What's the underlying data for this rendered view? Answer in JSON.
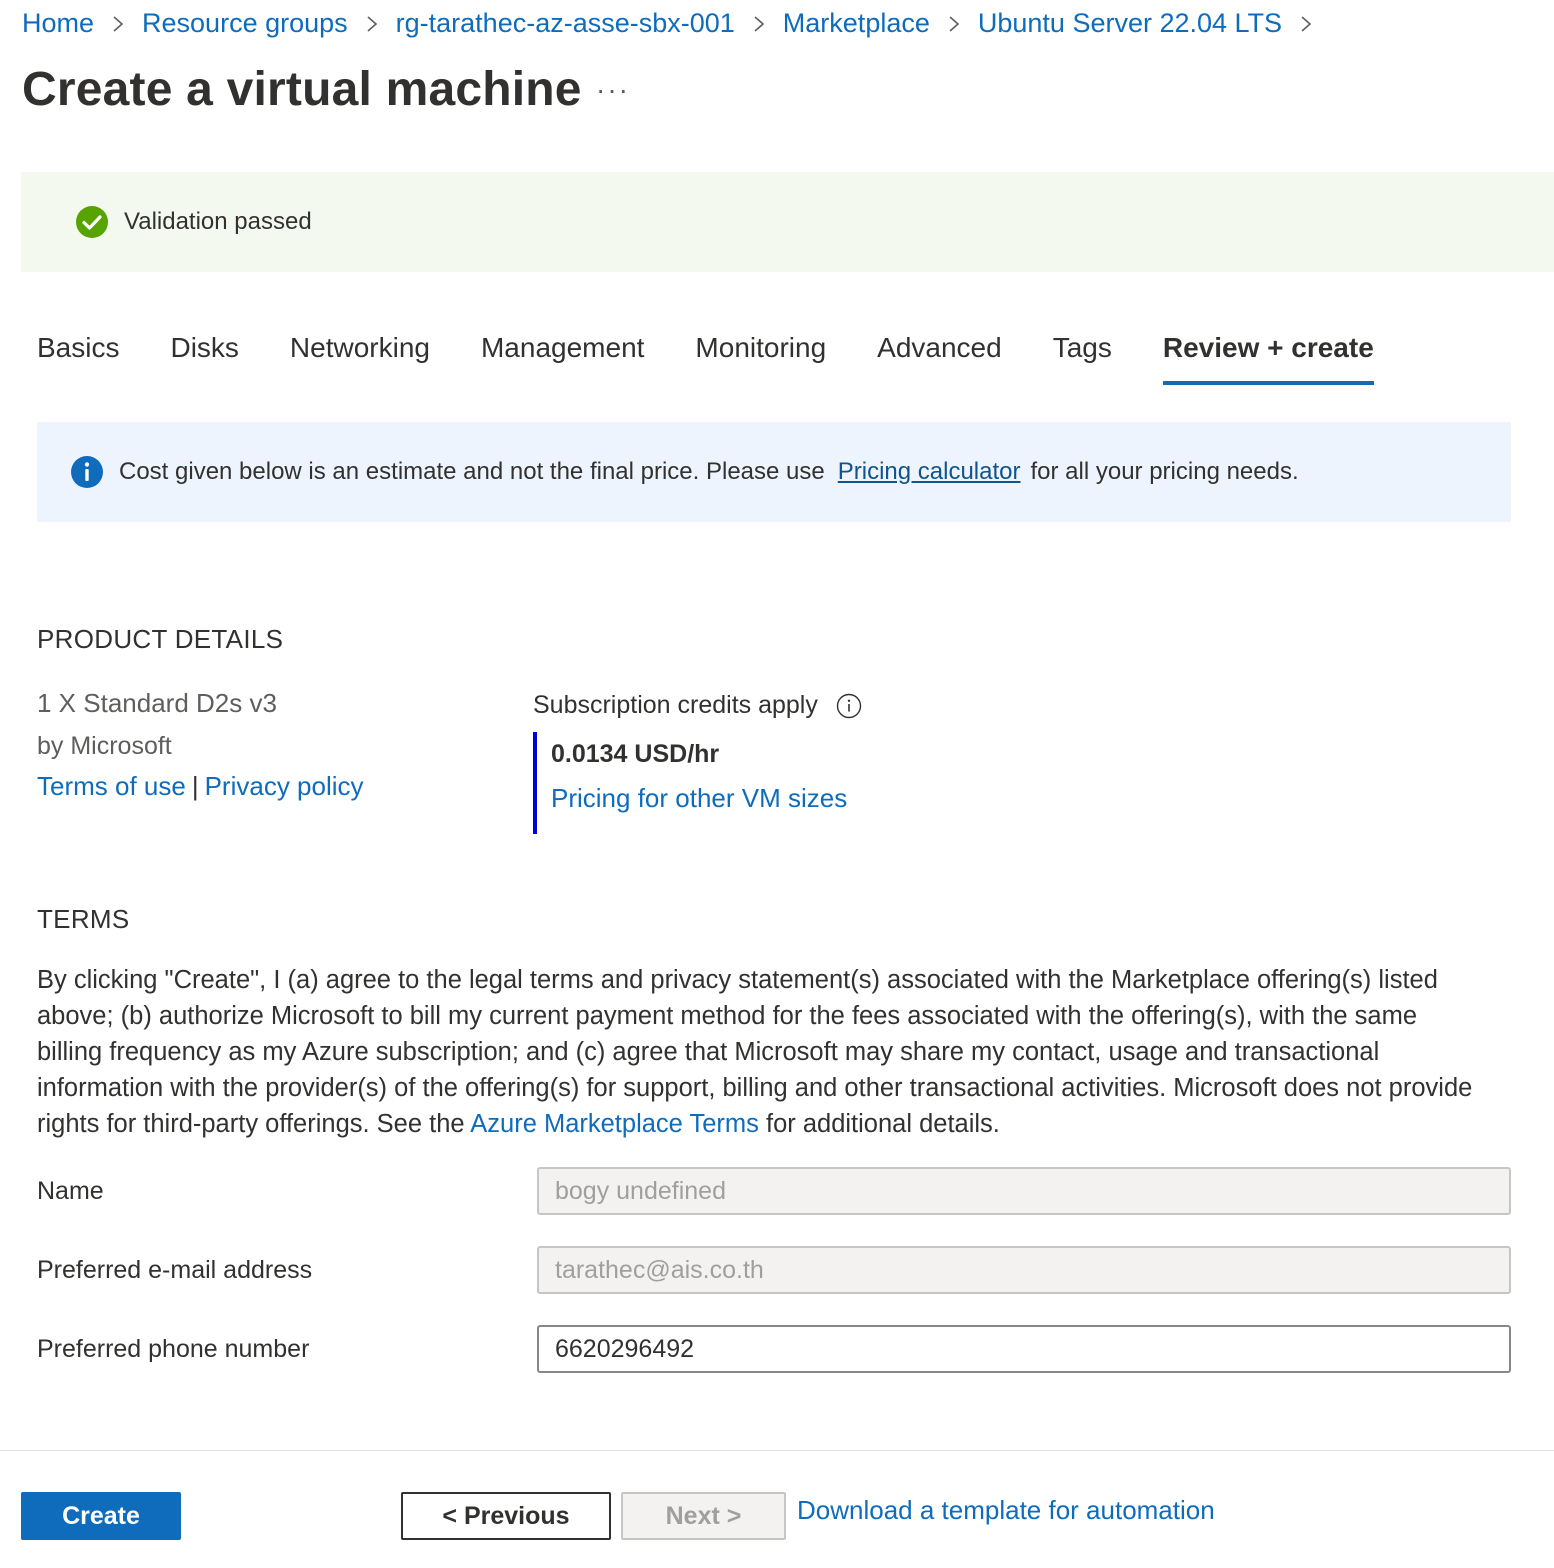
{
  "breadcrumb": {
    "items": [
      {
        "label": "Home"
      },
      {
        "label": "Resource groups"
      },
      {
        "label": "rg-tarathec-az-asse-sbx-001"
      },
      {
        "label": "Marketplace"
      },
      {
        "label": "Ubuntu Server 22.04 LTS"
      }
    ]
  },
  "header": {
    "title": "Create a virtual machine",
    "more_label": "···"
  },
  "validation": {
    "text": "Validation passed",
    "status_color": "#57a300"
  },
  "tabs": [
    {
      "label": "Basics",
      "active": false
    },
    {
      "label": "Disks",
      "active": false
    },
    {
      "label": "Networking",
      "active": false
    },
    {
      "label": "Management",
      "active": false
    },
    {
      "label": "Monitoring",
      "active": false
    },
    {
      "label": "Advanced",
      "active": false
    },
    {
      "label": "Tags",
      "active": false
    },
    {
      "label": "Review + create",
      "active": true
    }
  ],
  "info_bar": {
    "text_before": "Cost given below is an estimate and not the final price. Please use",
    "link": "Pricing calculator",
    "text_after": "for all your pricing needs."
  },
  "product": {
    "heading": "PRODUCT DETAILS",
    "name": "1 X Standard D2s v3",
    "by": "by Microsoft",
    "terms_link": "Terms of use",
    "separator": "|",
    "privacy_link": "Privacy policy",
    "credits_label": "Subscription credits apply",
    "price": "0.0134 USD/hr",
    "pricing_link": "Pricing for other VM sizes"
  },
  "terms": {
    "heading": "TERMS",
    "body_before": "By clicking \"Create\", I (a) agree to the legal terms and privacy statement(s) associated with the Marketplace offering(s) listed above; (b) authorize Microsoft to bill my current payment method for the fees associated with the offering(s), with the same billing frequency as my Azure subscription; and (c) agree that Microsoft may share my contact, usage and transactional information with the provider(s) of the offering(s) for support, billing and other transactional activities. Microsoft does not provide rights for third-party offerings. See the",
    "link": "Azure Marketplace Terms",
    "body_after": "for additional details."
  },
  "form": {
    "name_label": "Name",
    "name_value": "bogy undefined",
    "email_label": "Preferred e-mail address",
    "email_value": "tarathec@ais.co.th",
    "phone_label": "Preferred phone number",
    "phone_value": "6620296492"
  },
  "footer": {
    "create_label": "Create",
    "previous_label": "< Previous",
    "next_label": "Next >",
    "template_link": "Download a template for automation"
  },
  "colors": {
    "accent": "#0f6cbd",
    "validation_bg": "#f3f9ee",
    "info_bg": "#eef4fd",
    "price_border": "#0000d8"
  },
  "icons": {
    "validation": "check-circle-icon",
    "info": "info-icon",
    "credits_help": "info-outline-icon",
    "breadcrumb_separator": "chevron-right-icon"
  }
}
